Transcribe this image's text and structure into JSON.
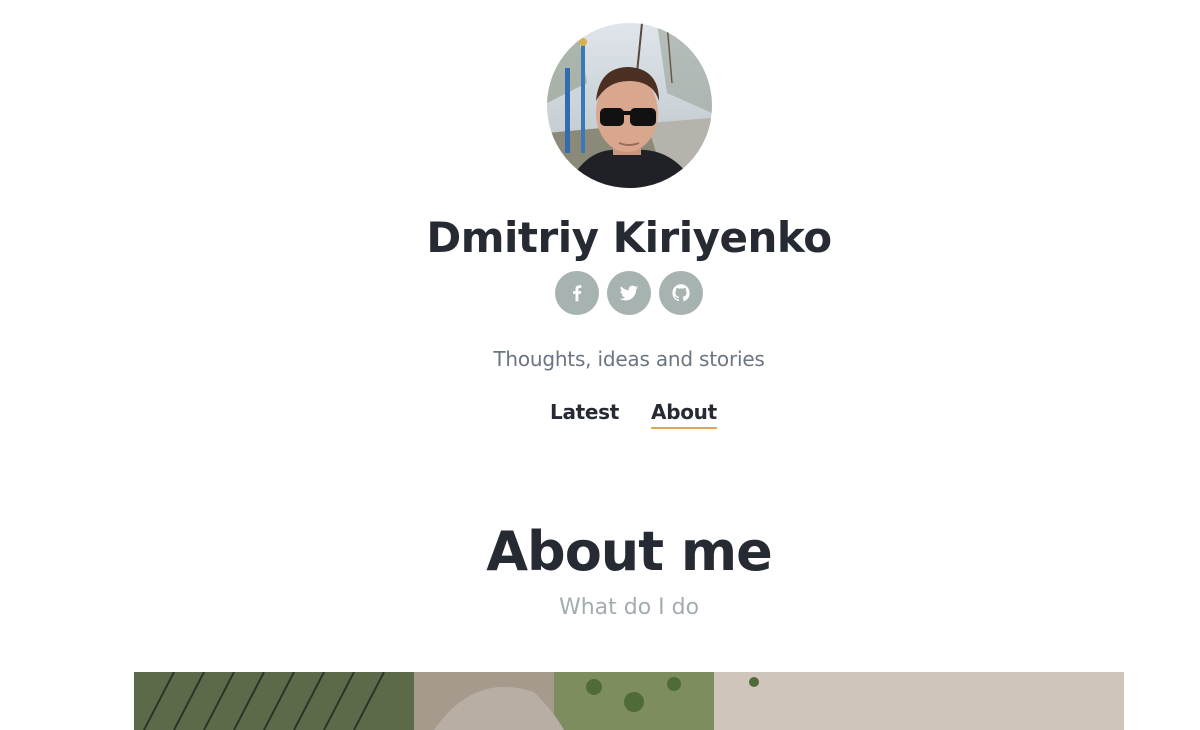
{
  "header": {
    "author_name": "Dmitriy Kiriyenko",
    "tagline": "Thoughts, ideas and stories",
    "avatar_icon": "avatar-photo",
    "social": [
      {
        "name": "facebook",
        "icon": "facebook-icon"
      },
      {
        "name": "twitter",
        "icon": "twitter-icon"
      },
      {
        "name": "github",
        "icon": "github-icon"
      }
    ],
    "nav": [
      {
        "label": "Latest",
        "active": false
      },
      {
        "label": "About",
        "active": true
      }
    ]
  },
  "page": {
    "title": "About me",
    "subtitle": "What do I do"
  },
  "colors": {
    "text_dark": "#252a33",
    "tagline": "#6a7582",
    "subtitle": "#a2adb0",
    "social_bg": "#a7b3b1",
    "nav_underline": "#e0a45a"
  }
}
